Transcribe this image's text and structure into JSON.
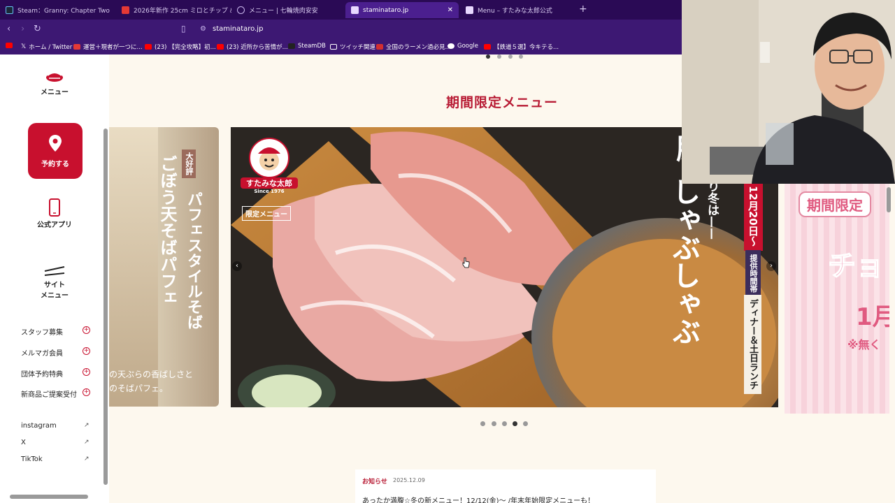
{
  "tabs": [
    {
      "label": "Steam：Granny: Chapter Two",
      "icon": "steam-icon",
      "active": false
    },
    {
      "label": "2026年新作 25cm ミロとチップ ぬいぐるみ",
      "icon": "shop-icon",
      "active": false
    },
    {
      "label": "メニュー | 七輪焼肉安安",
      "icon": "globe-icon",
      "active": false
    },
    {
      "label": "staminataro.jp",
      "icon": "site-icon",
      "active": true
    },
    {
      "label": "Menu – すたみな太郎公式",
      "icon": "site-icon",
      "active": false
    }
  ],
  "address": {
    "url": "staminataro.jp"
  },
  "bookmarks": [
    {
      "label": "",
      "icon": "youtube-icon"
    },
    {
      "label": "ホーム / Twitter",
      "icon": "x-icon"
    },
    {
      "label": "運営＋現者が一つに...",
      "icon": "bookmark-icon"
    },
    {
      "label": "(23) 【完全攻略】初...",
      "icon": "youtube-icon"
    },
    {
      "label": "(23) 近所から苦情が...",
      "icon": "youtube-icon"
    },
    {
      "label": "SteamDB",
      "icon": "steamdb-icon"
    },
    {
      "label": "ツイッチ関連",
      "icon": "folder-icon"
    },
    {
      "label": "全国のラーメン過必見...",
      "icon": "ramen-icon"
    },
    {
      "label": "Google",
      "icon": "google-icon"
    },
    {
      "label": "【鉄道５選】今キテる...",
      "icon": "youtube-icon"
    }
  ],
  "sidebar": {
    "menu_label": "メニュー",
    "reserve_label": "予約する",
    "app_label": "公式アプリ",
    "site_menu_label_1": "サイト",
    "site_menu_label_2": "メニュー",
    "links": [
      {
        "label": "スタッフ募集"
      },
      {
        "label": "メルマガ会員"
      },
      {
        "label": "団体予約特典"
      },
      {
        "label": "新商品ご提案受付"
      }
    ],
    "social": [
      {
        "label": "instagram"
      },
      {
        "label": "X"
      },
      {
        "label": "TikTok"
      }
    ]
  },
  "main": {
    "section_title": "期間限定メニュー",
    "carousel": {
      "left_slide": {
        "badge": "大好評",
        "title_1": "パフェスタイルそば",
        "title_2": "ごぼう天そばパフェ",
        "caption": "の天ぷらの香ばしさと\nのそばパフェ。"
      },
      "main_slide": {
        "brand": "すたみな太郎",
        "since": "Since 1976",
        "limited_tag": "限定メニュー",
        "date": "12月20日〜",
        "intro": "り冬は——",
        "hours_label": "提供時間帯",
        "hours": "ディナー＆土日ランチ",
        "dish": "しゃぶしゃぶ",
        "dish_top": "肌"
      },
      "right_slide": {
        "banner": "期間限定",
        "text_1": "チョ",
        "text_2": "1月",
        "note": "※無く"
      },
      "dots_count": 5,
      "active_dot": 3
    },
    "news": {
      "label": "お知らせ",
      "date": "2025.12.09",
      "text": "あったか満腹☆冬の新メニュー！12/12(金)〜 /年末年始限定メニューも！"
    }
  },
  "colors": {
    "brand_red": "#c8102e",
    "title_red": "#b81c35",
    "browser_purple": "#2a0a55"
  }
}
